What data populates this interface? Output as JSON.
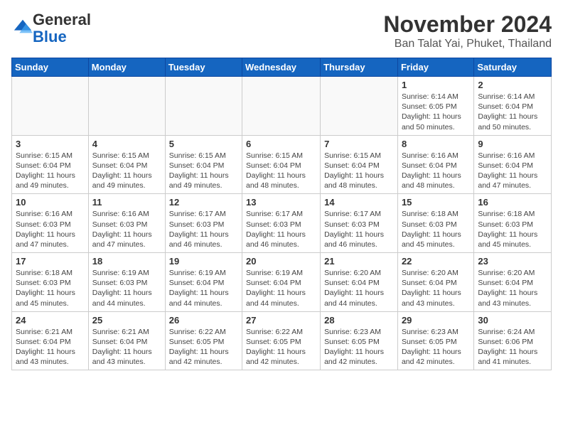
{
  "logo": {
    "general": "General",
    "blue": "Blue"
  },
  "header": {
    "month": "November 2024",
    "location": "Ban Talat Yai, Phuket, Thailand"
  },
  "weekdays": [
    "Sunday",
    "Monday",
    "Tuesday",
    "Wednesday",
    "Thursday",
    "Friday",
    "Saturday"
  ],
  "weeks": [
    [
      {
        "day": "",
        "info": ""
      },
      {
        "day": "",
        "info": ""
      },
      {
        "day": "",
        "info": ""
      },
      {
        "day": "",
        "info": ""
      },
      {
        "day": "",
        "info": ""
      },
      {
        "day": "1",
        "info": "Sunrise: 6:14 AM\nSunset: 6:05 PM\nDaylight: 11 hours and 50 minutes."
      },
      {
        "day": "2",
        "info": "Sunrise: 6:14 AM\nSunset: 6:04 PM\nDaylight: 11 hours and 50 minutes."
      }
    ],
    [
      {
        "day": "3",
        "info": "Sunrise: 6:15 AM\nSunset: 6:04 PM\nDaylight: 11 hours and 49 minutes."
      },
      {
        "day": "4",
        "info": "Sunrise: 6:15 AM\nSunset: 6:04 PM\nDaylight: 11 hours and 49 minutes."
      },
      {
        "day": "5",
        "info": "Sunrise: 6:15 AM\nSunset: 6:04 PM\nDaylight: 11 hours and 49 minutes."
      },
      {
        "day": "6",
        "info": "Sunrise: 6:15 AM\nSunset: 6:04 PM\nDaylight: 11 hours and 48 minutes."
      },
      {
        "day": "7",
        "info": "Sunrise: 6:15 AM\nSunset: 6:04 PM\nDaylight: 11 hours and 48 minutes."
      },
      {
        "day": "8",
        "info": "Sunrise: 6:16 AM\nSunset: 6:04 PM\nDaylight: 11 hours and 48 minutes."
      },
      {
        "day": "9",
        "info": "Sunrise: 6:16 AM\nSunset: 6:04 PM\nDaylight: 11 hours and 47 minutes."
      }
    ],
    [
      {
        "day": "10",
        "info": "Sunrise: 6:16 AM\nSunset: 6:03 PM\nDaylight: 11 hours and 47 minutes."
      },
      {
        "day": "11",
        "info": "Sunrise: 6:16 AM\nSunset: 6:03 PM\nDaylight: 11 hours and 47 minutes."
      },
      {
        "day": "12",
        "info": "Sunrise: 6:17 AM\nSunset: 6:03 PM\nDaylight: 11 hours and 46 minutes."
      },
      {
        "day": "13",
        "info": "Sunrise: 6:17 AM\nSunset: 6:03 PM\nDaylight: 11 hours and 46 minutes."
      },
      {
        "day": "14",
        "info": "Sunrise: 6:17 AM\nSunset: 6:03 PM\nDaylight: 11 hours and 46 minutes."
      },
      {
        "day": "15",
        "info": "Sunrise: 6:18 AM\nSunset: 6:03 PM\nDaylight: 11 hours and 45 minutes."
      },
      {
        "day": "16",
        "info": "Sunrise: 6:18 AM\nSunset: 6:03 PM\nDaylight: 11 hours and 45 minutes."
      }
    ],
    [
      {
        "day": "17",
        "info": "Sunrise: 6:18 AM\nSunset: 6:03 PM\nDaylight: 11 hours and 45 minutes."
      },
      {
        "day": "18",
        "info": "Sunrise: 6:19 AM\nSunset: 6:03 PM\nDaylight: 11 hours and 44 minutes."
      },
      {
        "day": "19",
        "info": "Sunrise: 6:19 AM\nSunset: 6:04 PM\nDaylight: 11 hours and 44 minutes."
      },
      {
        "day": "20",
        "info": "Sunrise: 6:19 AM\nSunset: 6:04 PM\nDaylight: 11 hours and 44 minutes."
      },
      {
        "day": "21",
        "info": "Sunrise: 6:20 AM\nSunset: 6:04 PM\nDaylight: 11 hours and 44 minutes."
      },
      {
        "day": "22",
        "info": "Sunrise: 6:20 AM\nSunset: 6:04 PM\nDaylight: 11 hours and 43 minutes."
      },
      {
        "day": "23",
        "info": "Sunrise: 6:20 AM\nSunset: 6:04 PM\nDaylight: 11 hours and 43 minutes."
      }
    ],
    [
      {
        "day": "24",
        "info": "Sunrise: 6:21 AM\nSunset: 6:04 PM\nDaylight: 11 hours and 43 minutes."
      },
      {
        "day": "25",
        "info": "Sunrise: 6:21 AM\nSunset: 6:04 PM\nDaylight: 11 hours and 43 minutes."
      },
      {
        "day": "26",
        "info": "Sunrise: 6:22 AM\nSunset: 6:05 PM\nDaylight: 11 hours and 42 minutes."
      },
      {
        "day": "27",
        "info": "Sunrise: 6:22 AM\nSunset: 6:05 PM\nDaylight: 11 hours and 42 minutes."
      },
      {
        "day": "28",
        "info": "Sunrise: 6:23 AM\nSunset: 6:05 PM\nDaylight: 11 hours and 42 minutes."
      },
      {
        "day": "29",
        "info": "Sunrise: 6:23 AM\nSunset: 6:05 PM\nDaylight: 11 hours and 42 minutes."
      },
      {
        "day": "30",
        "info": "Sunrise: 6:24 AM\nSunset: 6:06 PM\nDaylight: 11 hours and 41 minutes."
      }
    ]
  ]
}
